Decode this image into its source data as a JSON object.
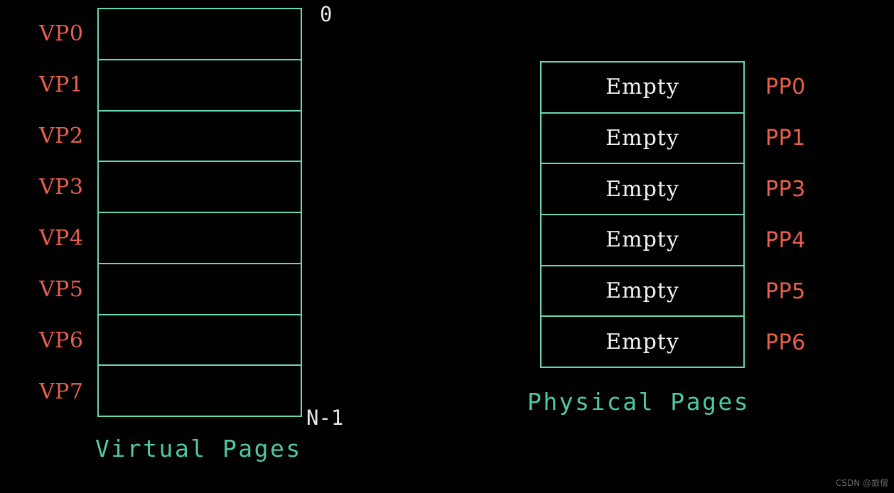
{
  "diagram": {
    "background_color": "#000000",
    "box_border_color": "#66d9b0",
    "label_color": "#e8604c",
    "caption_color": "#4fc9a5",
    "marker_color": "#e8e8e8",
    "cell_text_color": "#f2f2f2"
  },
  "virtual_pages": {
    "caption": "Virtual Pages",
    "top_marker": "0",
    "bottom_marker": "N-1",
    "rows": [
      {
        "label": "VP0",
        "content": ""
      },
      {
        "label": "VP1",
        "content": ""
      },
      {
        "label": "VP2",
        "content": ""
      },
      {
        "label": "VP3",
        "content": ""
      },
      {
        "label": "VP4",
        "content": ""
      },
      {
        "label": "VP5",
        "content": ""
      },
      {
        "label": "VP6",
        "content": ""
      },
      {
        "label": "VP7",
        "content": ""
      }
    ]
  },
  "physical_pages": {
    "caption": "Physical Pages",
    "rows": [
      {
        "label": "PP0",
        "content": "Empty"
      },
      {
        "label": "PP1",
        "content": "Empty"
      },
      {
        "label": "PP3",
        "content": "Empty"
      },
      {
        "label": "PP4",
        "content": "Empty"
      },
      {
        "label": "PP5",
        "content": "Empty"
      },
      {
        "label": "PP6",
        "content": "Empty"
      }
    ]
  },
  "watermark": {
    "text": "CSDN @旅僧"
  }
}
